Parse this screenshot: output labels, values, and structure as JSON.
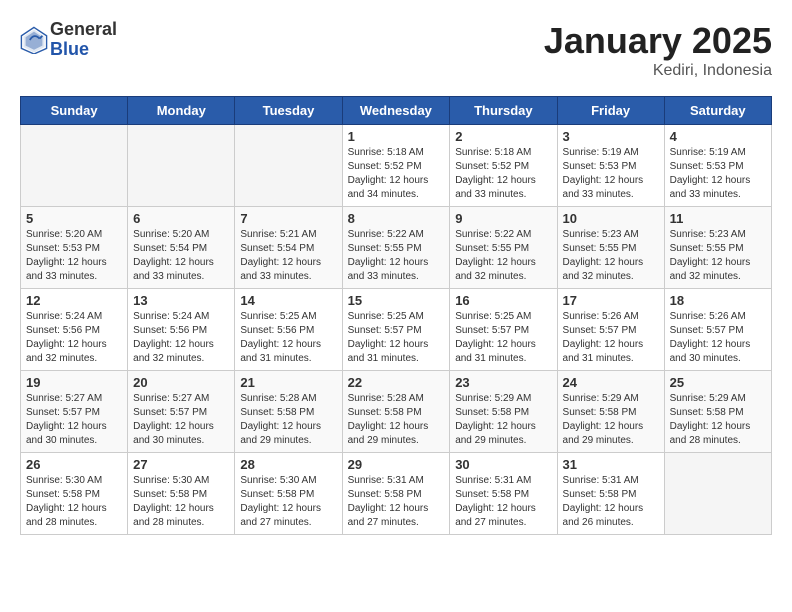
{
  "header": {
    "logo": {
      "general": "General",
      "blue": "Blue"
    },
    "title": "January 2025",
    "subtitle": "Kediri, Indonesia"
  },
  "calendar": {
    "weekdays": [
      "Sunday",
      "Monday",
      "Tuesday",
      "Wednesday",
      "Thursday",
      "Friday",
      "Saturday"
    ],
    "weeks": [
      [
        {
          "day": "",
          "info": ""
        },
        {
          "day": "",
          "info": ""
        },
        {
          "day": "",
          "info": ""
        },
        {
          "day": "1",
          "info": "Sunrise: 5:18 AM\nSunset: 5:52 PM\nDaylight: 12 hours\nand 34 minutes."
        },
        {
          "day": "2",
          "info": "Sunrise: 5:18 AM\nSunset: 5:52 PM\nDaylight: 12 hours\nand 33 minutes."
        },
        {
          "day": "3",
          "info": "Sunrise: 5:19 AM\nSunset: 5:53 PM\nDaylight: 12 hours\nand 33 minutes."
        },
        {
          "day": "4",
          "info": "Sunrise: 5:19 AM\nSunset: 5:53 PM\nDaylight: 12 hours\nand 33 minutes."
        }
      ],
      [
        {
          "day": "5",
          "info": "Sunrise: 5:20 AM\nSunset: 5:53 PM\nDaylight: 12 hours\nand 33 minutes."
        },
        {
          "day": "6",
          "info": "Sunrise: 5:20 AM\nSunset: 5:54 PM\nDaylight: 12 hours\nand 33 minutes."
        },
        {
          "day": "7",
          "info": "Sunrise: 5:21 AM\nSunset: 5:54 PM\nDaylight: 12 hours\nand 33 minutes."
        },
        {
          "day": "8",
          "info": "Sunrise: 5:22 AM\nSunset: 5:55 PM\nDaylight: 12 hours\nand 33 minutes."
        },
        {
          "day": "9",
          "info": "Sunrise: 5:22 AM\nSunset: 5:55 PM\nDaylight: 12 hours\nand 32 minutes."
        },
        {
          "day": "10",
          "info": "Sunrise: 5:23 AM\nSunset: 5:55 PM\nDaylight: 12 hours\nand 32 minutes."
        },
        {
          "day": "11",
          "info": "Sunrise: 5:23 AM\nSunset: 5:55 PM\nDaylight: 12 hours\nand 32 minutes."
        }
      ],
      [
        {
          "day": "12",
          "info": "Sunrise: 5:24 AM\nSunset: 5:56 PM\nDaylight: 12 hours\nand 32 minutes."
        },
        {
          "day": "13",
          "info": "Sunrise: 5:24 AM\nSunset: 5:56 PM\nDaylight: 12 hours\nand 32 minutes."
        },
        {
          "day": "14",
          "info": "Sunrise: 5:25 AM\nSunset: 5:56 PM\nDaylight: 12 hours\nand 31 minutes."
        },
        {
          "day": "15",
          "info": "Sunrise: 5:25 AM\nSunset: 5:57 PM\nDaylight: 12 hours\nand 31 minutes."
        },
        {
          "day": "16",
          "info": "Sunrise: 5:25 AM\nSunset: 5:57 PM\nDaylight: 12 hours\nand 31 minutes."
        },
        {
          "day": "17",
          "info": "Sunrise: 5:26 AM\nSunset: 5:57 PM\nDaylight: 12 hours\nand 31 minutes."
        },
        {
          "day": "18",
          "info": "Sunrise: 5:26 AM\nSunset: 5:57 PM\nDaylight: 12 hours\nand 30 minutes."
        }
      ],
      [
        {
          "day": "19",
          "info": "Sunrise: 5:27 AM\nSunset: 5:57 PM\nDaylight: 12 hours\nand 30 minutes."
        },
        {
          "day": "20",
          "info": "Sunrise: 5:27 AM\nSunset: 5:57 PM\nDaylight: 12 hours\nand 30 minutes."
        },
        {
          "day": "21",
          "info": "Sunrise: 5:28 AM\nSunset: 5:58 PM\nDaylight: 12 hours\nand 29 minutes."
        },
        {
          "day": "22",
          "info": "Sunrise: 5:28 AM\nSunset: 5:58 PM\nDaylight: 12 hours\nand 29 minutes."
        },
        {
          "day": "23",
          "info": "Sunrise: 5:29 AM\nSunset: 5:58 PM\nDaylight: 12 hours\nand 29 minutes."
        },
        {
          "day": "24",
          "info": "Sunrise: 5:29 AM\nSunset: 5:58 PM\nDaylight: 12 hours\nand 29 minutes."
        },
        {
          "day": "25",
          "info": "Sunrise: 5:29 AM\nSunset: 5:58 PM\nDaylight: 12 hours\nand 28 minutes."
        }
      ],
      [
        {
          "day": "26",
          "info": "Sunrise: 5:30 AM\nSunset: 5:58 PM\nDaylight: 12 hours\nand 28 minutes."
        },
        {
          "day": "27",
          "info": "Sunrise: 5:30 AM\nSunset: 5:58 PM\nDaylight: 12 hours\nand 28 minutes."
        },
        {
          "day": "28",
          "info": "Sunrise: 5:30 AM\nSunset: 5:58 PM\nDaylight: 12 hours\nand 27 minutes."
        },
        {
          "day": "29",
          "info": "Sunrise: 5:31 AM\nSunset: 5:58 PM\nDaylight: 12 hours\nand 27 minutes."
        },
        {
          "day": "30",
          "info": "Sunrise: 5:31 AM\nSunset: 5:58 PM\nDaylight: 12 hours\nand 27 minutes."
        },
        {
          "day": "31",
          "info": "Sunrise: 5:31 AM\nSunset: 5:58 PM\nDaylight: 12 hours\nand 26 minutes."
        },
        {
          "day": "",
          "info": ""
        }
      ]
    ]
  }
}
